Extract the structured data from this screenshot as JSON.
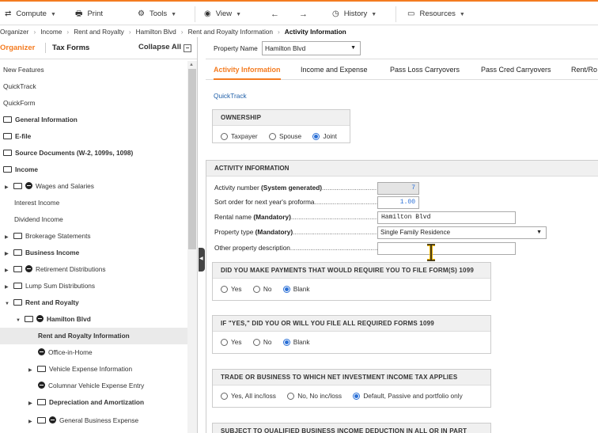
{
  "toolbar": {
    "compute": "Compute",
    "print": "Print",
    "tools": "Tools",
    "view": "View",
    "history": "History",
    "resources": "Resources"
  },
  "breadcrumbs": [
    "Organizer",
    "Income",
    "Rent and Royalty",
    "Hamilton Blvd",
    "Rent and Royalty Information",
    "Activity Information"
  ],
  "sidebar": {
    "tab_organizer": "Organizer",
    "tab_forms": "Tax Forms",
    "collapse": "Collapse All",
    "items": [
      {
        "label": "New Features"
      },
      {
        "label": "QuickTrack"
      },
      {
        "label": "QuickForm"
      },
      {
        "label": "General Information"
      },
      {
        "label": "E-file"
      },
      {
        "label": "Source Documents (W-2, 1099s, 1098)"
      },
      {
        "label": "Income"
      },
      {
        "label": "Wages and Salaries"
      },
      {
        "label": "Interest Income"
      },
      {
        "label": "Dividend Income"
      },
      {
        "label": "Brokerage Statements"
      },
      {
        "label": "Business Income"
      },
      {
        "label": "Retirement Distributions"
      },
      {
        "label": "Lump Sum Distributions"
      },
      {
        "label": "Rent and Royalty"
      },
      {
        "label": "Hamilton Blvd"
      },
      {
        "label": "Rent and Royalty Information"
      },
      {
        "label": "Office-in-Home"
      },
      {
        "label": "Vehicle Expense Information"
      },
      {
        "label": "Columnar Vehicle Expense Entry"
      },
      {
        "label": "Depreciation and Amortization"
      },
      {
        "label": "General Business Expense"
      }
    ]
  },
  "main": {
    "property_label": "Property Name",
    "property_value": "Hamilton Blvd",
    "tabs": [
      "Activity Information",
      "Income and Expense",
      "Pass Loss Carryovers",
      "Pass Cred Carryovers",
      "Rent/Ro"
    ],
    "quicktrack": "QuickTrack",
    "ownership": {
      "title": "OWNERSHIP",
      "options": [
        "Taxpayer",
        "Spouse",
        "Joint"
      ],
      "selected": "Joint"
    },
    "activity": {
      "title": "ACTIVITY INFORMATION",
      "fields": [
        {
          "label_pre": "Activity number ",
          "label_bold": "(System generated)",
          "value": "7"
        },
        {
          "label_pre": "Sort order for next year's proforma",
          "label_bold": "",
          "value": "1.00"
        },
        {
          "label_pre": "Rental name ",
          "label_bold": "(Mandatory)",
          "value": "Hamilton Blvd"
        },
        {
          "label_pre": "Property type ",
          "label_bold": "(Mandatory)",
          "value": "Single Family Residence"
        },
        {
          "label_pre": "Other property description",
          "label_bold": "",
          "value": ""
        }
      ]
    },
    "q1099": {
      "title": "DID YOU MAKE PAYMENTS THAT WOULD REQUIRE YOU TO FILE FORM(S) 1099",
      "options": [
        "Yes",
        "No",
        "Blank"
      ],
      "selected": "Blank"
    },
    "qfiled": {
      "title": "IF \"YES,\" DID YOU OR WILL YOU FILE ALL REQUIRED FORMS 1099",
      "options": [
        "Yes",
        "No",
        "Blank"
      ],
      "selected": "Blank"
    },
    "qniit": {
      "title": "TRADE OR BUSINESS TO WHICH NET INVESTMENT INCOME TAX APPLIES",
      "options": [
        "Yes, All inc/loss",
        "No, No inc/loss",
        "Default, Passive and portfolio only"
      ],
      "selected": "Default, Passive and portfolio only"
    },
    "qbi": {
      "title": "SUBJECT TO QUALIFIED BUSINESS INCOME DEDUCTION IN ALL OR IN PART"
    }
  },
  "colors": {
    "accent": "#f47b20",
    "radio": "#2a6fd6",
    "link": "#1f5fa8"
  }
}
